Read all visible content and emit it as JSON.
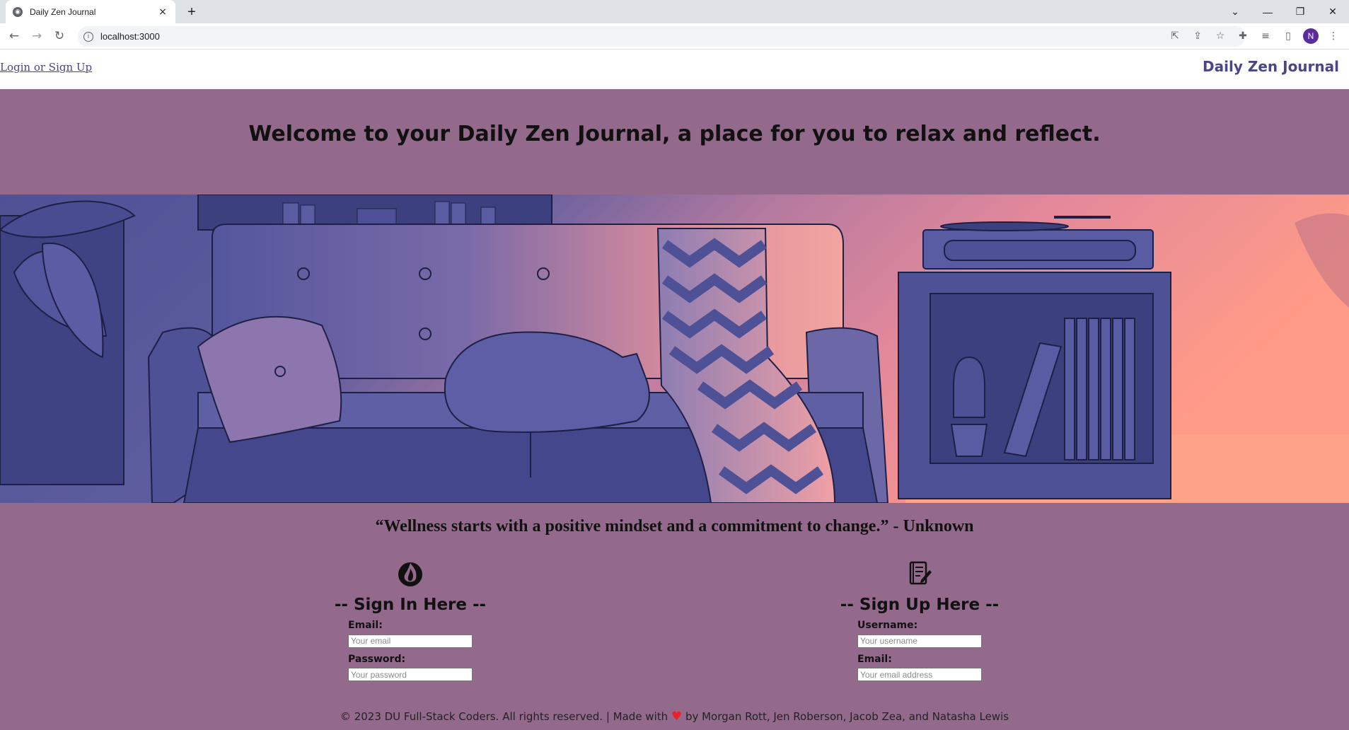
{
  "browser": {
    "tab_title": "Daily Zen Journal",
    "tab_close": "×",
    "new_tab": "+",
    "url": "localhost:3000",
    "profile_initial": "N"
  },
  "header": {
    "login_link": "Login or Sign Up",
    "brand": "Daily Zen Journal"
  },
  "hero": {
    "welcome": "Welcome to your Daily Zen Journal, a place for you to relax and reflect.",
    "quote": "“Wellness starts with a positive mindset and a commitment to change.” - Unknown"
  },
  "sign_in": {
    "heading": "-- Sign In Here --",
    "email_label": "Email:",
    "email_placeholder": "Your email",
    "password_label": "Password:",
    "password_placeholder": "Your password"
  },
  "sign_up": {
    "heading": "-- Sign Up Here --",
    "username_label": "Username:",
    "username_placeholder": "Your username",
    "email_label": "Email:",
    "email_placeholder": "Your email address"
  },
  "footer": {
    "copyright": "© 2023 DU Full-Stack Coders. All rights reserved. | Made with",
    "heart": "♥",
    "credits": "by Morgan Rott, Jen Roberson, Jacob Zea, and Natasha Lewis"
  },
  "colors": {
    "page_background": "#936a8b",
    "brand_text": "#4b4685",
    "chrome_background": "#dee1e6"
  }
}
